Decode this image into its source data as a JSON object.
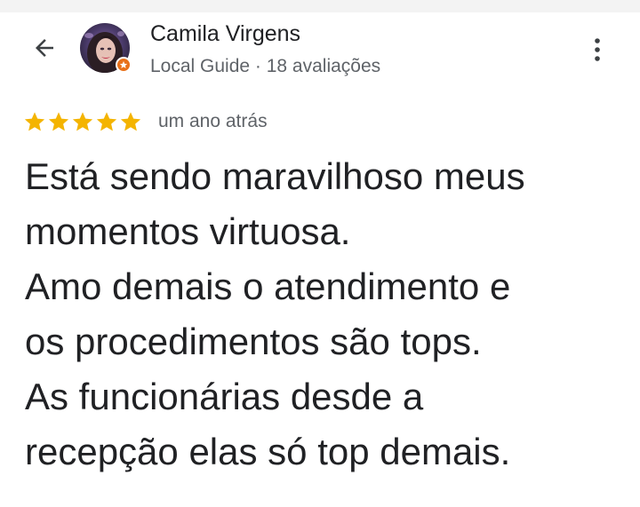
{
  "header": {
    "back_icon": "arrow-back-icon",
    "more_icon": "more-vertical-icon"
  },
  "reviewer": {
    "name": "Camila Virgens",
    "meta": "Local Guide · 18 avaliações",
    "badge_icon": "local-guide-star-icon",
    "badge_color": "#e8711a"
  },
  "review": {
    "rating": 5,
    "rating_max": 5,
    "star_color": "#f4b400",
    "time_ago": "um ano atrás",
    "text": "Está sendo maravilhoso meus\nmomentos virtuosa.\nAmo demais o atendimento e\nos procedimentos são tops.\nAs funcionárias desde a\nrecepção elas só top demais."
  }
}
